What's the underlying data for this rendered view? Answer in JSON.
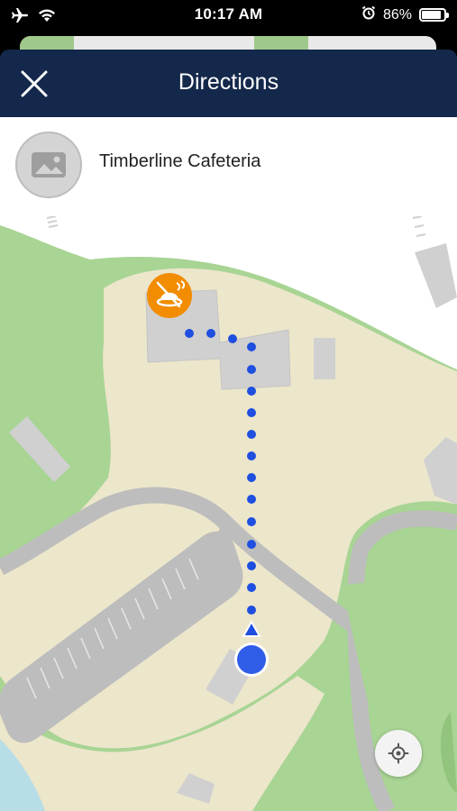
{
  "status_bar": {
    "time": "10:17 AM",
    "battery_text": "86%",
    "battery_level": 0.86,
    "icons": [
      "airplane-icon",
      "wifi-icon",
      "alarm-icon",
      "battery-icon"
    ]
  },
  "header": {
    "title": "Directions",
    "close_icon": "close-icon",
    "background": "#14284b"
  },
  "destination": {
    "name": "Timberline Cafeteria",
    "thumbnail_icon": "image-placeholder-icon"
  },
  "map": {
    "marker_icon": "cafeteria-marker-icon",
    "marker_color": "#f28c00",
    "route_color": "#1f4fe0",
    "user_location_color": "#2f5de8",
    "grass_color": "#a8d494",
    "ground_color": "#ece6cb",
    "road_color": "#bdbdbd",
    "building_color": "#d0d0d0"
  },
  "controls": {
    "locate_icon": "locate-me-icon"
  }
}
